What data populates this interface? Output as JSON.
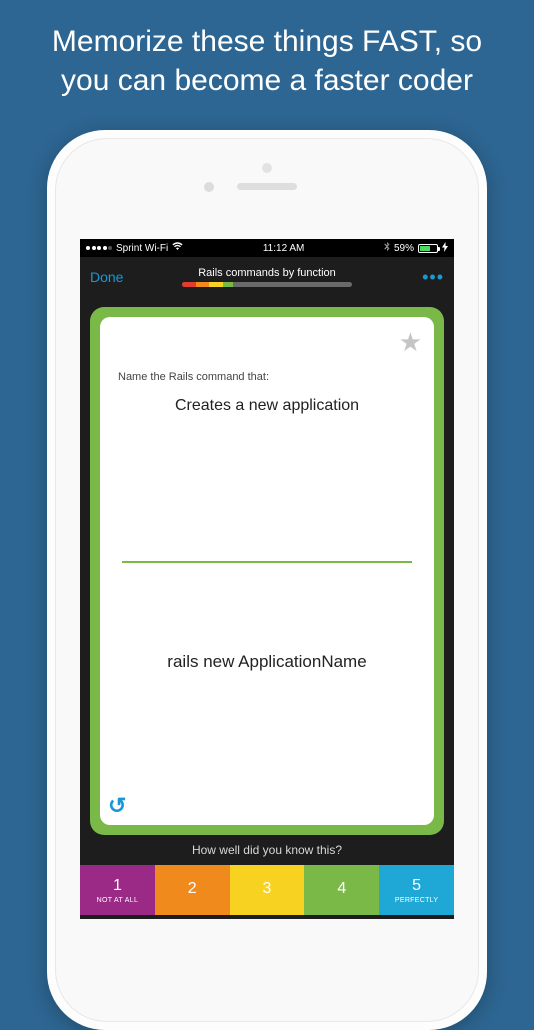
{
  "promo": {
    "line1": "Memorize these things FAST, so",
    "line2": "you can become a faster coder"
  },
  "status": {
    "carrier": "Sprint Wi-Fi",
    "time": "11:12 AM",
    "battery_pct": "59%"
  },
  "nav": {
    "done": "Done",
    "title": "Rails commands by function",
    "progress_segments": [
      {
        "color": "#e23b2f",
        "width": "8%"
      },
      {
        "color": "#f08a1d",
        "width": "8%"
      },
      {
        "color": "#f7d221",
        "width": "8%"
      },
      {
        "color": "#7ab848",
        "width": "6%"
      }
    ]
  },
  "card": {
    "prompt_label": "Name the Rails command that:",
    "prompt": "Creates a new application",
    "answer": "rails new ApplicationName"
  },
  "footer": {
    "question": "How well did you know this?",
    "ratings": [
      {
        "num": "1",
        "label": "NOT AT ALL",
        "color": "#9a2a86"
      },
      {
        "num": "2",
        "label": "",
        "color": "#f08a1d"
      },
      {
        "num": "3",
        "label": "",
        "color": "#f7d221"
      },
      {
        "num": "4",
        "label": "",
        "color": "#7ab848"
      },
      {
        "num": "5",
        "label": "PERFECTLY",
        "color": "#1fa8d6"
      }
    ]
  }
}
